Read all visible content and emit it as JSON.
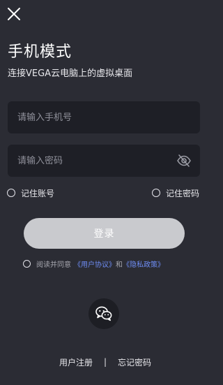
{
  "header": {
    "close_icon": "close-icon",
    "title": "手机模式",
    "subtitle": "连接VEGA云电脑上的虚拟桌面"
  },
  "form": {
    "phone": {
      "placeholder": "请输入手机号",
      "value": ""
    },
    "password": {
      "placeholder": "请输入密码",
      "value": "",
      "toggle_icon": "eye-slash-icon"
    },
    "remember_account": {
      "label": "记住账号",
      "checked": false
    },
    "remember_password": {
      "label": "记住密码",
      "checked": false
    },
    "login_button": "登录"
  },
  "agreement": {
    "checked": false,
    "prefix": "阅读并同意",
    "user_agreement": "《用户协议》",
    "and": "和",
    "privacy_policy": "《隐私政策》"
  },
  "social": {
    "wechat_icon": "wechat-icon"
  },
  "footer": {
    "register": "用户注册",
    "separator": "|",
    "forgot_password": "忘记密码"
  },
  "colors": {
    "background": "#2b2c34",
    "input_background": "#1e1f26",
    "login_button": "#c9cace",
    "link": "#6e8cf2"
  }
}
